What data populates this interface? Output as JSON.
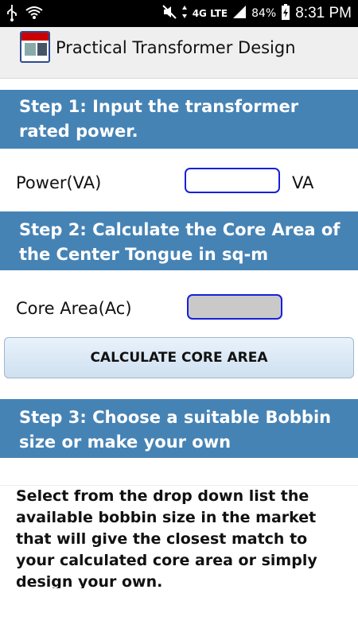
{
  "status_bar": {
    "network": "4G LTE",
    "battery": "84%",
    "time": "8:31 PM"
  },
  "action_bar": {
    "title": "Practical Transformer Design",
    "logo_text": "PRACTICAL TRANSFORMER DESIGN"
  },
  "step1": {
    "heading": "Step 1: Input the transformer rated power.",
    "label": "Power(VA)",
    "value": "",
    "unit": "VA"
  },
  "step2": {
    "heading": "Step 2: Calculate the  Core Area of the Center Tongue in sq-m",
    "label": "Core Area(Ac)",
    "value": "",
    "button_label": "CALCULATE CORE AREA"
  },
  "step3": {
    "heading": "Step 3: Choose a suitable Bobbin size or make your own",
    "description": "Select from the drop down list the available bobbin size in the market that will give the closest match to your calculated core area or simply design your own."
  },
  "colors": {
    "step_band": "#4683b5",
    "field_border": "#1820d8",
    "status_bar": "#000000"
  }
}
